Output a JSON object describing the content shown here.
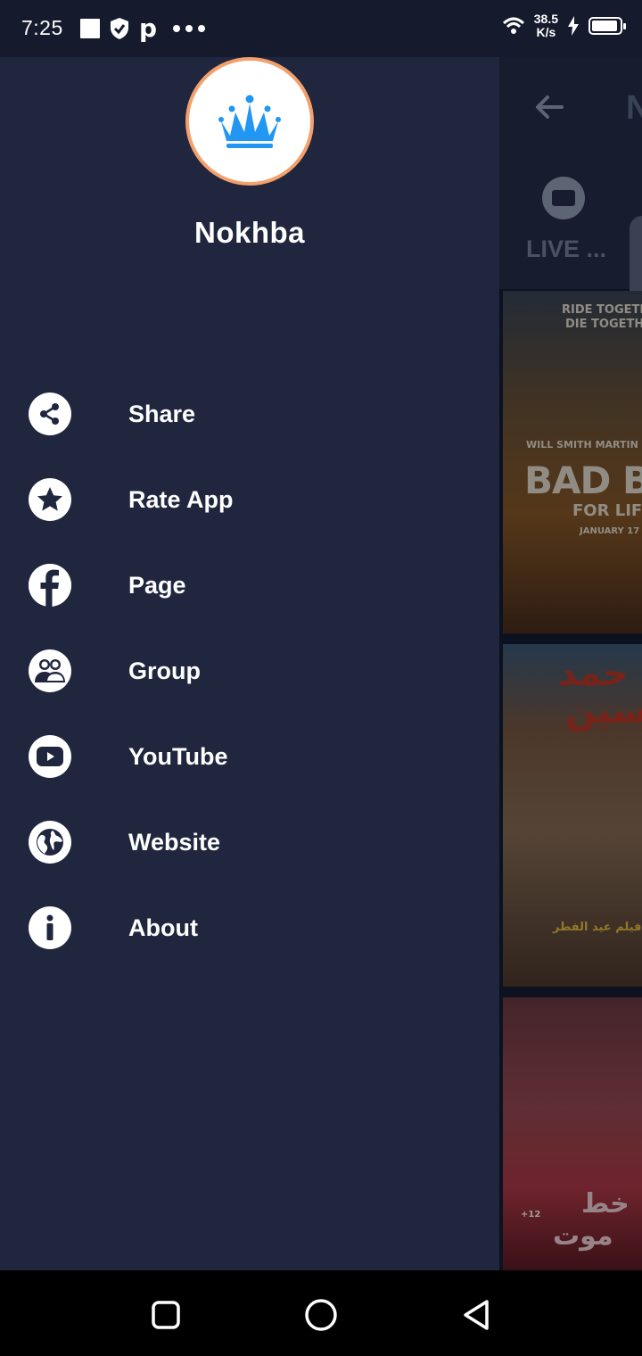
{
  "status_bar": {
    "time": "7:25",
    "speed_value": "38.5",
    "speed_unit": "K/s"
  },
  "drawer": {
    "app_name": "Nokhba",
    "menu": [
      {
        "label": "Share",
        "icon": "share-icon"
      },
      {
        "label": "Rate App",
        "icon": "star-icon"
      },
      {
        "label": "Page",
        "icon": "facebook-icon"
      },
      {
        "label": "Group",
        "icon": "group-icon"
      },
      {
        "label": "YouTube",
        "icon": "youtube-icon"
      },
      {
        "label": "Website",
        "icon": "globe-icon"
      },
      {
        "label": "About",
        "icon": "info-icon"
      }
    ]
  },
  "background": {
    "title_fragment": "N",
    "tab_live": "LIVE ...",
    "posters": [
      {
        "lines": [
          "RIDE TOGETHE",
          "DIE TOGETHER",
          "WILL SMITH  MARTIN L",
          "BAD BO",
          "FOR LIFE",
          "JANUARY 17"
        ]
      },
      {
        "lines": [
          "حمد",
          "سين",
          "فيلم عيد الفطر"
        ]
      },
      {
        "lines": [
          "خط",
          "موت",
          "+12"
        ]
      }
    ]
  },
  "colors": {
    "drawer_bg": "#1f263e",
    "status_bg": "#151b2c",
    "avatar_ring": "#f4a06c",
    "crown": "#2196f3"
  }
}
